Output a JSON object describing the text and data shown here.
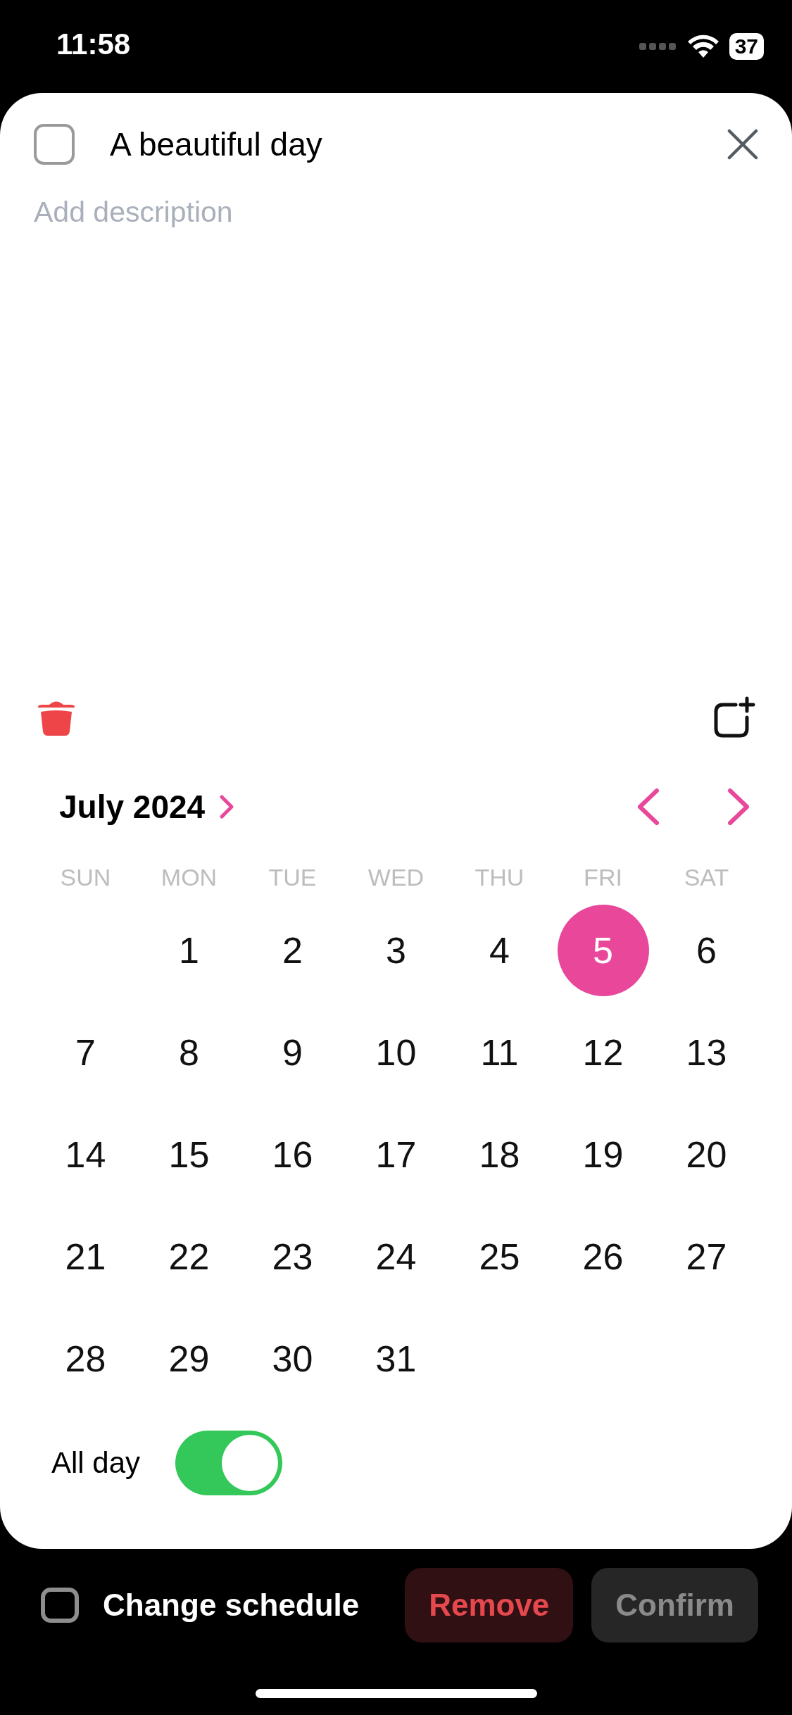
{
  "status_bar": {
    "time": "11:58",
    "battery": "37"
  },
  "task": {
    "checked": false,
    "title": "A beautiful day",
    "description": {
      "placeholder": "Add description"
    }
  },
  "calendar": {
    "month": "July 2024",
    "weekdays": [
      "SUN",
      "MON",
      "TUE",
      "WED",
      "THU",
      "FRI",
      "SAT"
    ],
    "weeks": [
      [
        {
          "day": "1",
          "selected": false
        },
        {
          "day": "2",
          "selected": false
        },
        {
          "day": "3",
          "selected": false
        },
        {
          "day": "4",
          "selected": false
        },
        {
          "day": "5",
          "selected": true
        },
        {
          "day": "6",
          "selected": false
        }
      ],
      [
        {
          "day": "7",
          "selected": false
        },
        {
          "day": "8",
          "selected": false
        },
        {
          "day": "9",
          "selected": false
        },
        {
          "day": "10",
          "selected": false
        },
        {
          "day": "11",
          "selected": false
        },
        {
          "day": "12",
          "selected": false
        },
        {
          "day": "13",
          "selected": false
        }
      ],
      [
        {
          "day": "14",
          "selected": false
        },
        {
          "day": "15",
          "selected": false
        },
        {
          "day": "16",
          "selected": false
        },
        {
          "day": "17",
          "selected": false
        },
        {
          "day": "18",
          "selected": false
        },
        {
          "day": "19",
          "selected": false
        },
        {
          "day": "20",
          "selected": false
        }
      ],
      [
        {
          "day": "21",
          "selected": false
        },
        {
          "day": "22",
          "selected": false
        },
        {
          "day": "23",
          "selected": false
        },
        {
          "day": "24",
          "selected": false
        },
        {
          "day": "25",
          "selected": false
        },
        {
          "day": "26",
          "selected": false
        },
        {
          "day": "27",
          "selected": false
        }
      ],
      [
        {
          "day": "28",
          "selected": false
        },
        {
          "day": "29",
          "selected": false
        },
        {
          "day": "30",
          "selected": false
        },
        {
          "day": "31",
          "selected": false
        }
      ]
    ]
  },
  "all_day": {
    "label": "All day",
    "on": true
  },
  "bottom_bar": {
    "change_schedule": {
      "label": "Change schedule",
      "checked": false
    },
    "buttons": [
      {
        "label": "Remove",
        "kind": "destructive",
        "disabled": false
      },
      {
        "label": "Confirm",
        "kind": "primary",
        "disabled": true
      }
    ]
  }
}
